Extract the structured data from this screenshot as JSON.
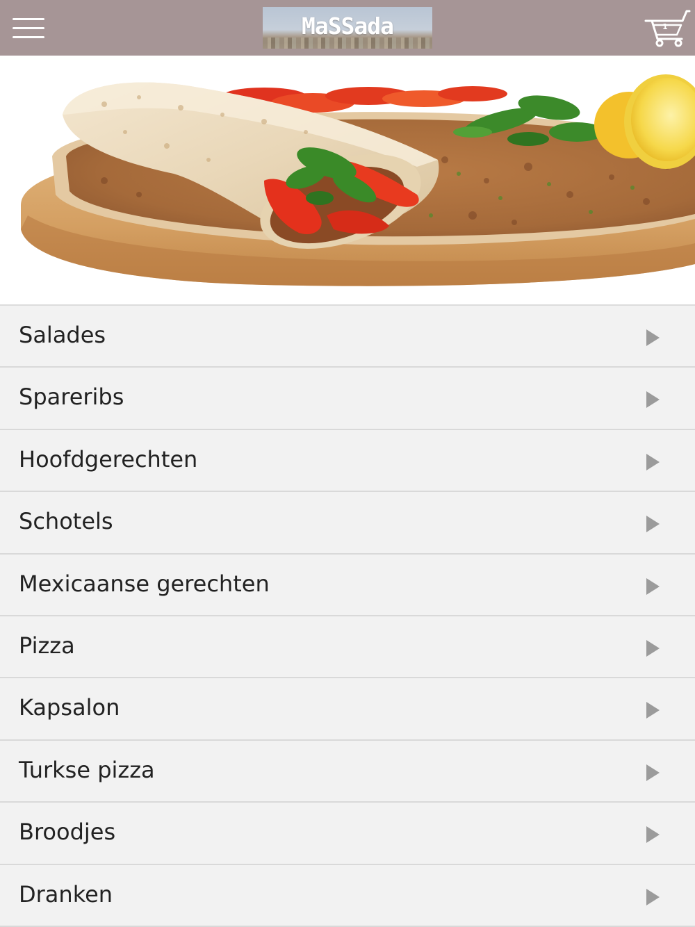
{
  "header": {
    "menu_icon": "hamburger-menu-icon",
    "logo_text": "MaSSada",
    "cart_icon": "shopping-cart-icon",
    "cart_count": "1",
    "background_color": "#a69596"
  },
  "hero": {
    "image": "lahmacun-wrap-on-wooden-board"
  },
  "categories": {
    "chevron_icon": "chevron-right-icon",
    "items": [
      {
        "label": "Salades"
      },
      {
        "label": "Spareribs"
      },
      {
        "label": "Hoofdgerechten"
      },
      {
        "label": "Schotels"
      },
      {
        "label": "Mexicaanse gerechten"
      },
      {
        "label": "Pizza"
      },
      {
        "label": "Kapsalon"
      },
      {
        "label": "Turkse pizza"
      },
      {
        "label": "Broodjes"
      },
      {
        "label": "Dranken"
      }
    ]
  }
}
